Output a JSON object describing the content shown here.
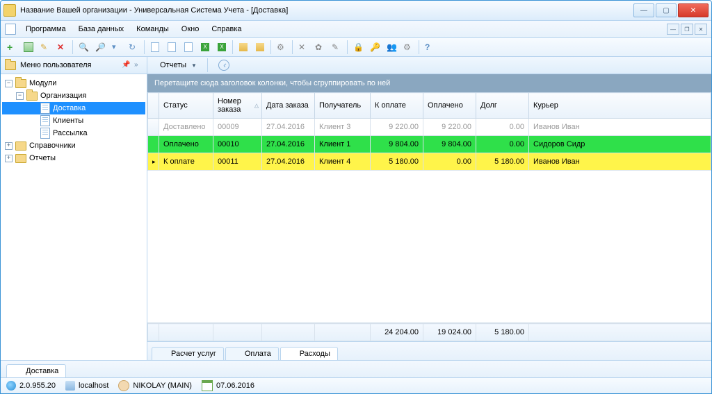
{
  "title": "Название Вашей организации - Универсальная Система Учета - [Доставка]",
  "menu": {
    "program": "Программа",
    "database": "База данных",
    "commands": "Команды",
    "window": "Окно",
    "help": "Справка"
  },
  "sidebar": {
    "title": "Меню пользователя",
    "modules": "Модули",
    "org": "Организация",
    "items": [
      "Доставка",
      "Клиенты",
      "Рассылка"
    ],
    "refs": "Справочники",
    "reports": "Отчеты"
  },
  "reportsBtn": "Отчеты",
  "groupHint": "Перетащите сюда заголовок колонки, чтобы сгруппировать по ней",
  "columns": {
    "status": "Статус",
    "orderNo": "Номер заказа",
    "orderDate": "Дата заказа",
    "recipient": "Получатель",
    "toPay": "К оплате",
    "paid": "Оплачено",
    "debt": "Долг",
    "courier": "Курьер"
  },
  "rows": [
    {
      "status": "Доставлено",
      "no": "00009",
      "date": "27.04.2016",
      "recipient": "Клиент 3",
      "toPay": "9 220.00",
      "paid": "9 220.00",
      "debt": "0.00",
      "courier": "Иванов Иван",
      "style": "gray",
      "current": false
    },
    {
      "status": "Оплачено",
      "no": "00010",
      "date": "27.04.2016",
      "recipient": "Клиент 1",
      "toPay": "9 804.00",
      "paid": "9 804.00",
      "debt": "0.00",
      "courier": "Сидоров Сидр",
      "style": "green",
      "current": false
    },
    {
      "status": "К оплате",
      "no": "00011",
      "date": "27.04.2016",
      "recipient": "Клиент 4",
      "toPay": "5 180.00",
      "paid": "0.00",
      "debt": "5 180.00",
      "courier": "Иванов Иван",
      "style": "yellow",
      "current": true
    }
  ],
  "totals": {
    "toPay": "24 204.00",
    "paid": "19 024.00",
    "debt": "5 180.00"
  },
  "bottomTabs": {
    "calc": "Расчет услуг",
    "pay": "Оплата",
    "exp": "Расходы"
  },
  "windowTab": "Доставка",
  "status": {
    "version": "2.0.955.20",
    "host": "localhost",
    "user": "NIKOLAY (MAIN)",
    "date": "07.06.2016"
  }
}
